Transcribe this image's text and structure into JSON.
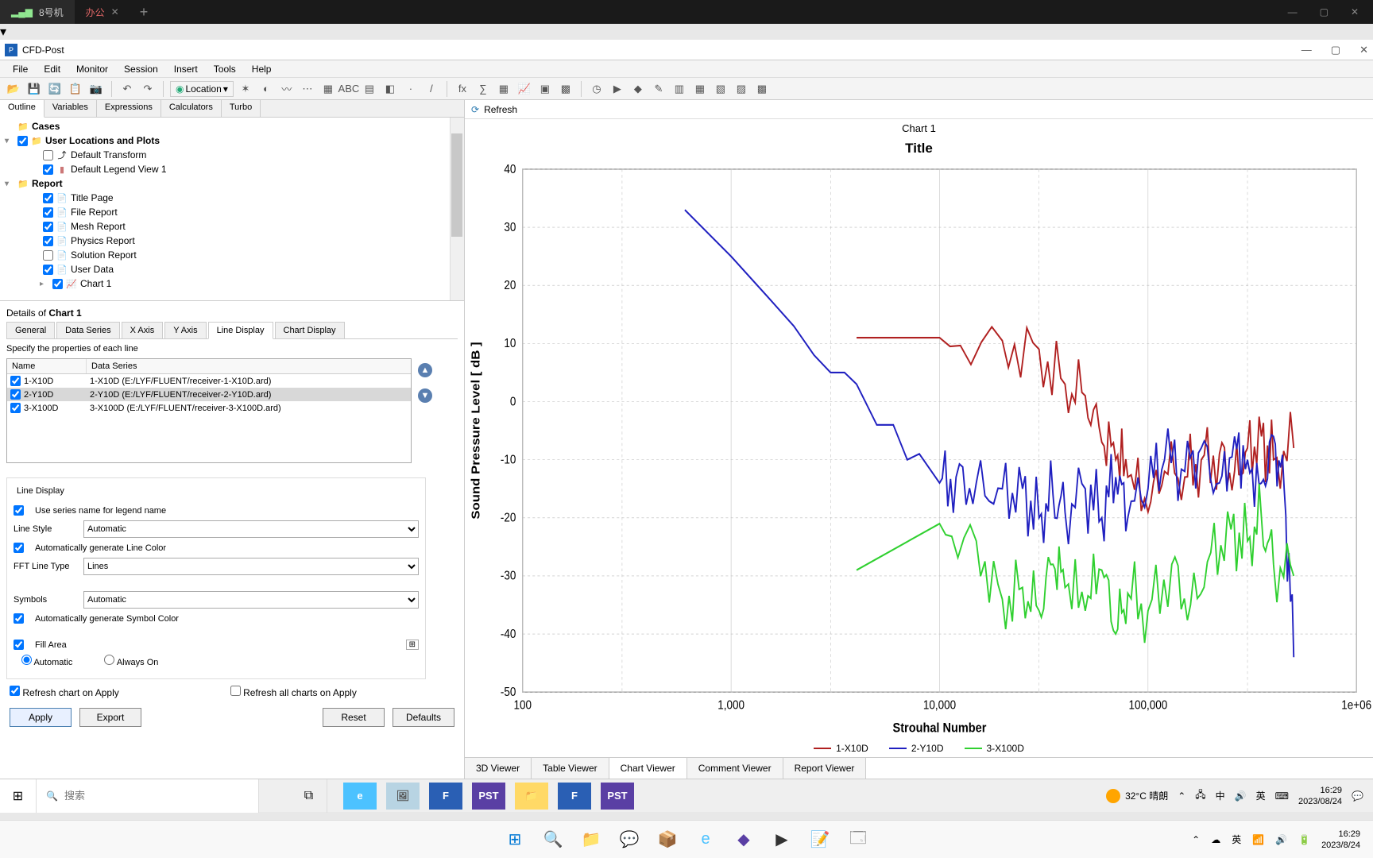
{
  "browser_tabs": {
    "tab1": "8号机",
    "tab2": "办公"
  },
  "app_title": "CFD-Post",
  "menu": {
    "file": "File",
    "edit": "Edit",
    "monitor": "Monitor",
    "session": "Session",
    "insert": "Insert",
    "tools": "Tools",
    "help": "Help"
  },
  "toolbar": {
    "location": "Location"
  },
  "left_tabs": {
    "outline": "Outline",
    "variables": "Variables",
    "expressions": "Expressions",
    "calculators": "Calculators",
    "turbo": "Turbo"
  },
  "tree": {
    "cases": "Cases",
    "ulp": "User Locations and Plots",
    "default_transform": "Default Transform",
    "default_legend": "Default Legend View 1",
    "report": "Report",
    "title_page": "Title Page",
    "file_report": "File Report",
    "mesh_report": "Mesh Report",
    "physics_report": "Physics Report",
    "solution_report": "Solution Report",
    "user_data": "User Data",
    "chart1": "Chart 1"
  },
  "details_header_prefix": "Details of ",
  "details_header_item": "Chart 1",
  "detail_tabs": {
    "general": "General",
    "data_series": "Data Series",
    "xaxis": "X Axis",
    "yaxis": "Y Axis",
    "line_display": "Line Display",
    "chart_display": "Chart Display"
  },
  "prop_instruction": "Specify the properties of each line",
  "series_headers": {
    "name": "Name",
    "data_series": "Data Series"
  },
  "series": {
    "s0": {
      "name": "1-X10D",
      "ds": "1-X10D (E:/LYF/FLUENT/receiver-1-X10D.ard)"
    },
    "s1": {
      "name": "2-Y10D",
      "ds": "2-Y10D (E:/LYF/FLUENT/receiver-2-Y10D.ard)"
    },
    "s2": {
      "name": "3-X100D",
      "ds": "3-X100D (E:/LYF/FLUENT/receiver-3-X100D.ard)"
    }
  },
  "line_display": {
    "group": "Line Display",
    "use_series_name": "Use series name for legend name",
    "line_style_label": "Line Style",
    "line_style_value": "Automatic",
    "auto_color": "Automatically generate Line Color",
    "fft_label": "FFT Line Type",
    "fft_value": "Lines",
    "symbols_label": "Symbols",
    "symbols_value": "Automatic",
    "auto_symbol_color": "Automatically generate Symbol Color",
    "fill_area": "Fill Area",
    "automatic": "Automatic",
    "always_on": "Always On"
  },
  "bottom": {
    "refresh_on_apply": "Refresh chart on Apply",
    "refresh_all": "Refresh all charts on Apply",
    "apply": "Apply",
    "export": "Export",
    "reset": "Reset",
    "defaults": "Defaults"
  },
  "chart_header": "Chart 1",
  "chart_title": "Title",
  "refresh": "Refresh",
  "viewer_tabs": {
    "v3d": "3D Viewer",
    "table": "Table Viewer",
    "chart": "Chart Viewer",
    "comment": "Comment Viewer",
    "report": "Report Viewer"
  },
  "legend": {
    "s1": "1-X10D",
    "s2": "2-Y10D",
    "s3": "3-X100D"
  },
  "colors": {
    "s1": "#b02020",
    "s2": "#2020c0",
    "s3": "#30d030"
  },
  "chart_data": {
    "type": "line",
    "title": "Title",
    "xlabel": "Strouhal Number",
    "ylabel": "Sound Pressure Level [ dB ]",
    "xlim": [
      100,
      1000000
    ],
    "ylim": [
      -50,
      40
    ],
    "xscale": "log",
    "xticks": [
      100,
      1000,
      10000,
      100000,
      1000000
    ],
    "xticklabels": [
      "100",
      "1,000",
      "10,000",
      "100,000",
      "1e+06"
    ],
    "yticks": [
      -50,
      -40,
      -30,
      -20,
      -10,
      0,
      10,
      20,
      30,
      40
    ],
    "series": [
      {
        "name": "1-X10D",
        "color": "#b02020",
        "x": [
          4000,
          10000,
          20000,
          30000,
          40000,
          50000,
          60000,
          70000,
          80000,
          100000,
          120000,
          150000,
          180000,
          220000,
          260000,
          300000,
          350000,
          400000,
          500000
        ],
        "y": [
          11,
          11,
          10.5,
          9,
          3,
          1,
          -7,
          -10,
          -13,
          -19,
          -12,
          -13,
          -10,
          -9,
          -12,
          -8,
          -6,
          -10,
          -8
        ]
      },
      {
        "name": "2-Y10D",
        "color": "#2020c0",
        "x": [
          600,
          1000,
          1500,
          2000,
          2500,
          3000,
          3500,
          4000,
          5000,
          6000,
          7000,
          8000,
          10000,
          12000,
          15000,
          20000,
          25000,
          30000,
          35000,
          40000,
          50000,
          60000,
          70000,
          80000,
          100000,
          120000,
          150000,
          180000,
          220000,
          260000,
          300000,
          350000,
          400000,
          450000,
          500000
        ],
        "y": [
          33,
          25,
          18,
          13,
          8,
          5,
          5,
          3,
          -4,
          -4,
          -10,
          -9,
          -14,
          -13,
          -14,
          -15,
          -15,
          -20,
          -16,
          -19,
          -15,
          -20,
          -13,
          -20,
          -15,
          -10,
          -12,
          -8,
          -14,
          -6,
          -10,
          -14,
          -6,
          -15,
          -44
        ]
      },
      {
        "name": "3-X100D",
        "color": "#30d030",
        "x": [
          4000,
          10000,
          15000,
          20000,
          25000,
          30000,
          35000,
          40000,
          50000,
          60000,
          70000,
          80000,
          100000,
          130000,
          160000,
          200000,
          250000,
          300000,
          350000,
          400000,
          500000
        ],
        "y": [
          -29,
          -21,
          -24,
          -34,
          -32,
          -36,
          -28,
          -32,
          -36,
          -29,
          -40,
          -33,
          -36,
          -28,
          -35,
          -26,
          -22,
          -24,
          -20,
          -28,
          -30
        ]
      }
    ]
  },
  "inner_taskbar": {
    "search_placeholder": "搜索",
    "weather": "32°C 晴朗",
    "ime": "中",
    "kb": "英",
    "time": "16:29",
    "date": "2023/08/24"
  },
  "outer_taskbar": {
    "time": "16:29",
    "date": "2023/8/24"
  }
}
